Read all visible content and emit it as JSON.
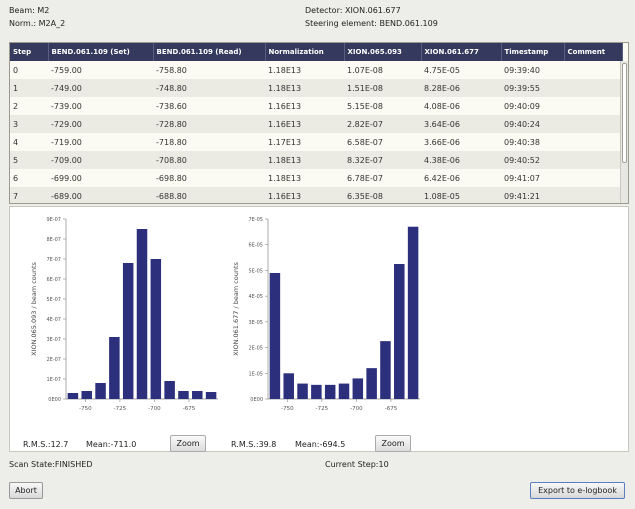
{
  "info": {
    "beam": "Beam: M2",
    "norm": "Norm.: M2A_2",
    "detector": "Detector: XION.061.677",
    "steering": "Steering element: BEND.061.109"
  },
  "table": {
    "columns": [
      "Step",
      "BEND.061.109 (Set)",
      "BEND.061.109 (Read)",
      "Normalization",
      "XION.065.093",
      "XION.061.677",
      "Timestamp",
      "Comment"
    ],
    "rows": [
      [
        "0",
        "-759.00",
        "-758.80",
        "1.18E13",
        "1.07E-08",
        "4.75E-05",
        "09:39:40",
        ""
      ],
      [
        "1",
        "-749.00",
        "-748.80",
        "1.18E13",
        "1.51E-08",
        "8.28E-06",
        "09:39:55",
        ""
      ],
      [
        "2",
        "-739.00",
        "-738.60",
        "1.16E13",
        "5.15E-08",
        "4.08E-06",
        "09:40:09",
        ""
      ],
      [
        "3",
        "-729.00",
        "-728.80",
        "1.16E13",
        "2.82E-07",
        "3.64E-06",
        "09:40:24",
        ""
      ],
      [
        "4",
        "-719.00",
        "-718.80",
        "1.17E13",
        "6.58E-07",
        "3.66E-06",
        "09:40:38",
        ""
      ],
      [
        "5",
        "-709.00",
        "-708.80",
        "1.18E13",
        "8.32E-07",
        "4.38E-06",
        "09:40:52",
        ""
      ],
      [
        "6",
        "-699.00",
        "-698.80",
        "1.18E13",
        "6.78E-07",
        "6.42E-06",
        "09:41:07",
        ""
      ],
      [
        "7",
        "-689.00",
        "-688.80",
        "1.16E13",
        "6.35E-08",
        "1.08E-05",
        "09:41:21",
        ""
      ]
    ]
  },
  "left_stats": {
    "rms": "R.M.S.:12.7",
    "mean": "Mean:-711.0",
    "zoom": "Zoom"
  },
  "right_stats": {
    "rms": "R.M.S.:39.8",
    "mean": "Mean:-694.5",
    "zoom": "Zoom"
  },
  "status": {
    "scan_state": "Scan State:FINISHED",
    "current_step": "Current Step:10"
  },
  "buttons": {
    "abort": "Abort",
    "export": "Export to e-logbook"
  },
  "colors": {
    "bar": "#2c2f7c",
    "header": "#35395e"
  },
  "chart_data": [
    {
      "type": "bar",
      "ylabel": "XION.065.093 / beam counts",
      "xlabel": "",
      "x": [
        -759,
        -749,
        -739,
        -729,
        -719,
        -709,
        -699,
        -689,
        -679,
        -669,
        -659
      ],
      "values": [
        3e-08,
        4e-08,
        8e-08,
        3.1e-07,
        6.8e-07,
        8.5e-07,
        7e-07,
        9e-08,
        4e-08,
        4e-08,
        3.5e-08
      ],
      "ylim": [
        0,
        9e-07
      ],
      "xlim": [
        -764,
        -654
      ],
      "yticks": [
        0,
        1e-07,
        2e-07,
        3e-07,
        4e-07,
        5e-07,
        6e-07,
        7e-07,
        8e-07,
        9e-07
      ],
      "ytick_labels": [
        "0E00",
        "1E-07",
        "2E-07",
        "3E-07",
        "4E-07",
        "5E-07",
        "6E-07",
        "7E-07",
        "8E-07",
        "9E-07"
      ],
      "xticks": [
        -750,
        -725,
        -700,
        -675
      ],
      "xtick_labels": [
        "-750",
        "-725",
        "-700",
        "-675"
      ]
    },
    {
      "type": "bar",
      "ylabel": "XION.061.677 / beam counts",
      "xlabel": "",
      "x": [
        -759,
        -749,
        -739,
        -729,
        -719,
        -709,
        -699,
        -689,
        -679,
        -669,
        -659
      ],
      "values": [
        4.9e-05,
        1e-05,
        6e-06,
        5.5e-06,
        5.5e-06,
        6e-06,
        8e-06,
        1.2e-05,
        2.25e-05,
        5.25e-05,
        6.7e-05
      ],
      "ylim": [
        0,
        7e-05
      ],
      "xlim": [
        -764,
        -654
      ],
      "yticks": [
        0,
        1e-05,
        2e-05,
        3e-05,
        4e-05,
        5e-05,
        6e-05,
        7e-05
      ],
      "ytick_labels": [
        "0E00",
        "1E-05",
        "2E-05",
        "3E-05",
        "4E-05",
        "5E-05",
        "6E-05",
        "7E-05"
      ],
      "xticks": [
        -750,
        -725,
        -700,
        -675
      ],
      "xtick_labels": [
        "-750",
        "-725",
        "-700",
        "-675"
      ]
    }
  ]
}
